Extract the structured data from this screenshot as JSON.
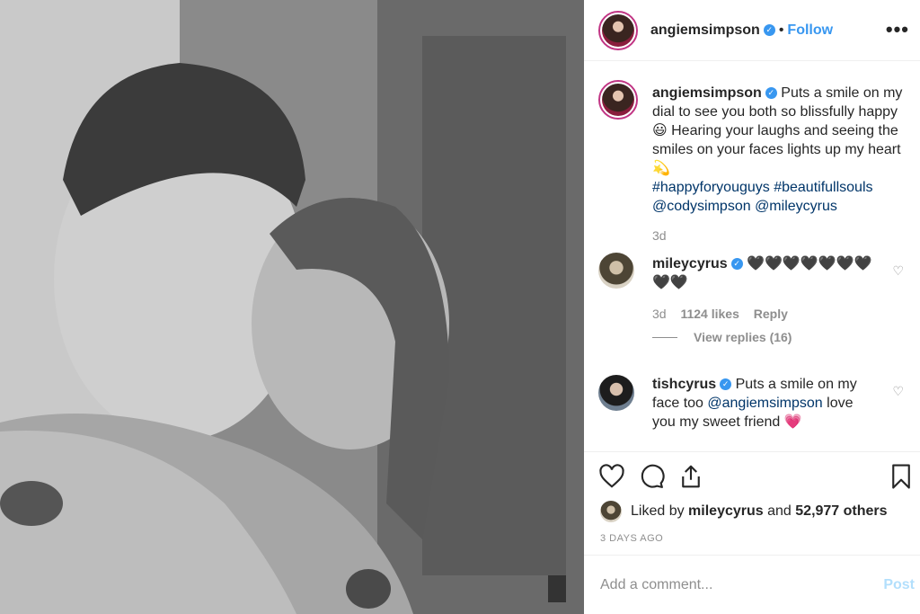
{
  "post": {
    "author": "angiemsimpson",
    "follow_label": "Follow",
    "separator": "•",
    "more_label": "•••"
  },
  "caption": {
    "author": "angiemsimpson",
    "text_1": "Puts a smile on my dial to see you both so blissfully happy 😃 Hearing your laughs and seeing the smiles on your faces lights up my heart 💫",
    "hashtags": "#happyforyouguys #beautifullsouls",
    "mentions": "@codysimpson @mileycyrus",
    "time": "3d"
  },
  "comments": [
    {
      "author": "mileycyrus",
      "text": "🖤🖤🖤🖤🖤🖤🖤🖤🖤",
      "time": "3d",
      "likes": "1124 likes",
      "reply_label": "Reply",
      "view_replies": "View replies (16)"
    },
    {
      "author": "tishcyrus",
      "text_1": "Puts a smile on my face too",
      "mention": "@angiemsimpson",
      "text_2": "love you my sweet friend 💗"
    }
  ],
  "likes": {
    "prefix": "Liked by",
    "user": "mileycyrus",
    "and": "and",
    "others": "52,977 others"
  },
  "date": "3 DAYS AGO",
  "add_comment": {
    "placeholder": "Add a comment...",
    "post_label": "Post"
  },
  "icons": {
    "like": "heart-icon",
    "comment": "comment-icon",
    "share": "share-icon",
    "save": "bookmark-icon",
    "verified": "verified-badge-icon"
  },
  "colors": {
    "accent": "#3897f0",
    "link": "#003569",
    "muted": "#8e8e8e",
    "post_disabled": "#b2dffc"
  }
}
